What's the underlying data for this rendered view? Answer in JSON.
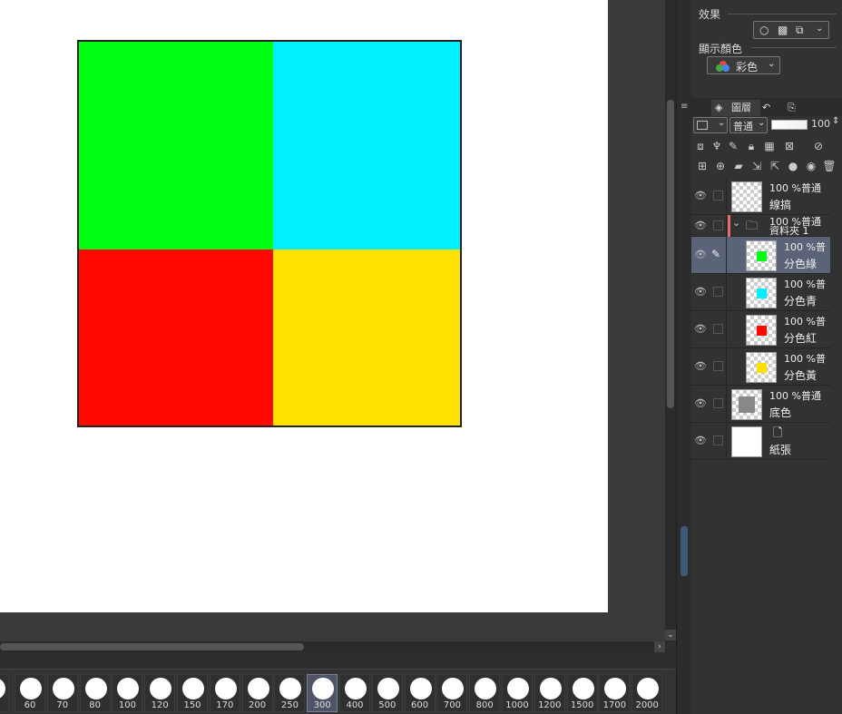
{
  "canvas": {
    "colors": {
      "green": "#00ff12",
      "cyan": "#00f0ff",
      "red": "#ff0800",
      "yellow": "#ffe100"
    }
  },
  "brush_sizes": {
    "items": [
      "60",
      "70",
      "80",
      "100",
      "120",
      "150",
      "170",
      "200",
      "250",
      "300",
      "400",
      "500",
      "600",
      "700",
      "800",
      "1000",
      "1200",
      "1500",
      "1700",
      "2000"
    ],
    "selected": "300"
  },
  "panel": {
    "effect_label": "效果",
    "display_color_label": "顯示顏色",
    "display_color_value": "彩色",
    "layer_tab_label": "圖層",
    "blend_mode": "普通",
    "opacity": "100"
  },
  "layers": [
    {
      "id": "line",
      "info": "100 %普通",
      "name": "線搞",
      "indent": 0,
      "swatch": null
    },
    {
      "id": "folder",
      "info": "100 %普通",
      "name": "資料夾 1",
      "indent": 0,
      "folder": true
    },
    {
      "id": "green",
      "info": "100 %普",
      "name": "分色綠",
      "indent": 1,
      "swatch": "#00ff12",
      "selected": true
    },
    {
      "id": "cyan",
      "info": "100 %普",
      "name": "分色青",
      "indent": 1,
      "swatch": "#00f0ff"
    },
    {
      "id": "red",
      "info": "100 %普",
      "name": "分色紅",
      "indent": 1,
      "swatch": "#ff0800"
    },
    {
      "id": "yellow",
      "info": "100 %普",
      "name": "分色黃",
      "indent": 1,
      "swatch": "#ffe100"
    },
    {
      "id": "base",
      "info": "100 %普通",
      "name": "底色",
      "indent": 0,
      "swatch": "#888888"
    },
    {
      "id": "paper",
      "info": "",
      "name": "紙張",
      "indent": 0,
      "paper": true
    }
  ]
}
